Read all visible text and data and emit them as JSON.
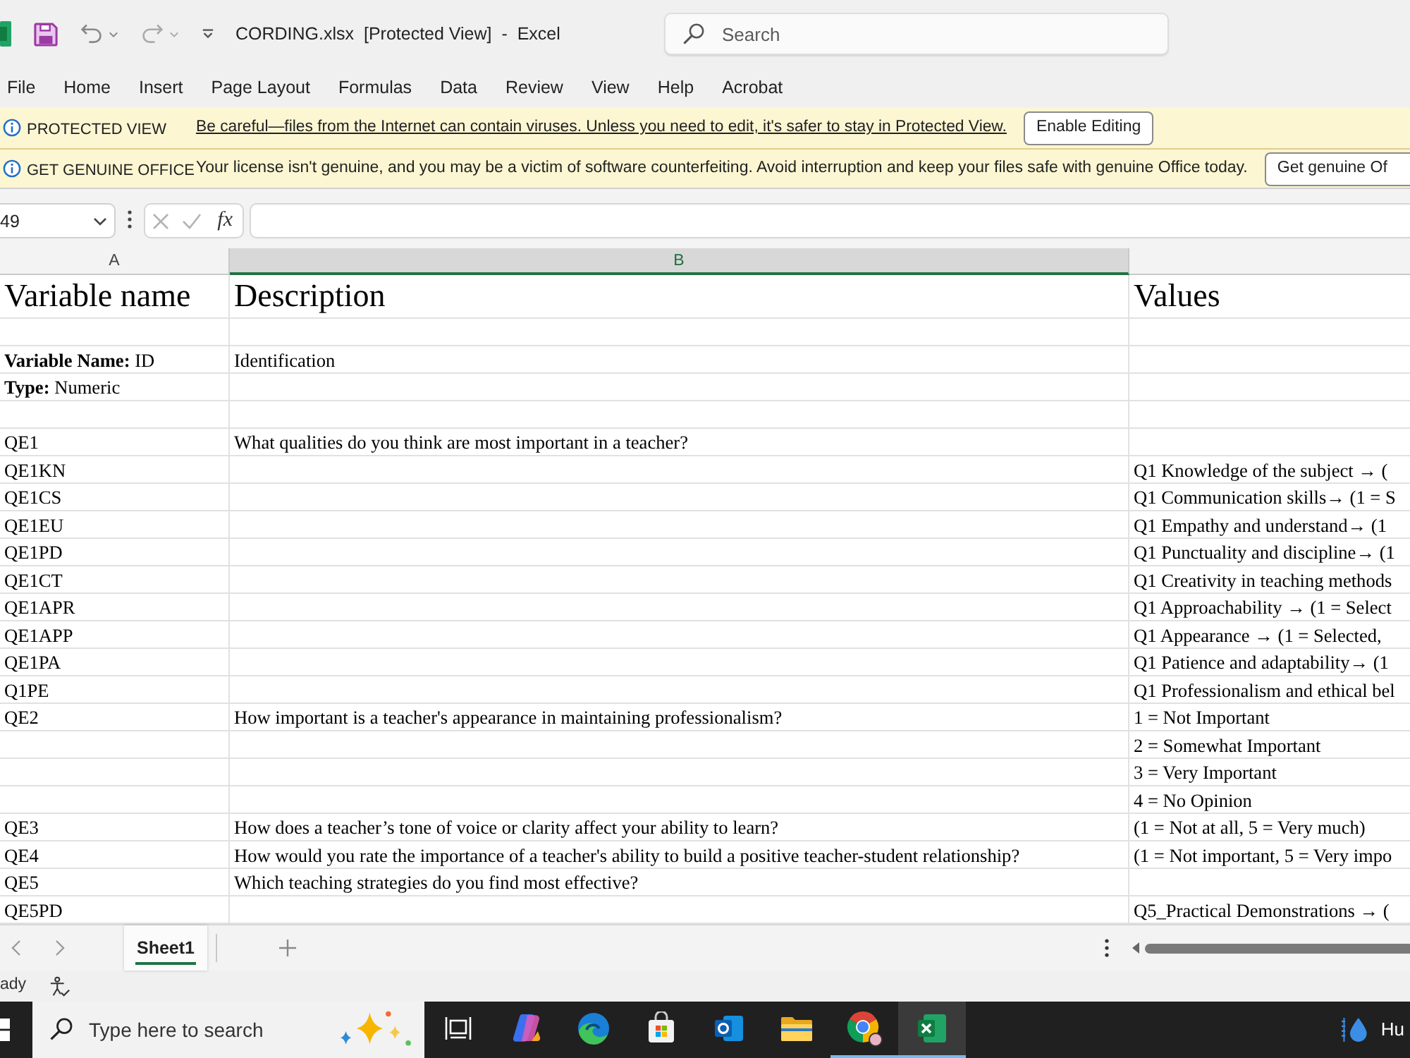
{
  "title_bar": {
    "title": "CORDING.xlsx  [Protected View]  -  Excel",
    "search": {
      "placeholder": "Search"
    }
  },
  "ribbon_tabs": [
    {
      "label": "File",
      "selected": false
    },
    {
      "label": "Home",
      "selected": false
    },
    {
      "label": "Insert",
      "selected": false
    },
    {
      "label": "Page Layout",
      "selected": false
    },
    {
      "label": "Formulas",
      "selected": false
    },
    {
      "label": "Data",
      "selected": false
    },
    {
      "label": "Review",
      "selected": false
    },
    {
      "label": "View",
      "selected": false
    },
    {
      "label": "Help",
      "selected": false
    },
    {
      "label": "Acrobat",
      "selected": false
    }
  ],
  "message_bars": [
    {
      "kind": "protected",
      "heading": "PROTECTED VIEW",
      "message": "Be careful—files from the Internet can contain viruses. Unless you need to edit, it's safer to stay in Protected View.",
      "button": "Enable Editing"
    },
    {
      "kind": "genuine",
      "heading": "GET GENUINE OFFICE",
      "message": "Your license isn't genuine, and you may be a victim of software counterfeiting. Avoid interruption and keep your files safe with genuine Office today.",
      "button": "Get genuine Of"
    }
  ],
  "formula_bar": {
    "name_box": "49",
    "function_label": "fx"
  },
  "columns": [
    {
      "label": "A",
      "selected": false
    },
    {
      "label": "B",
      "selected": true
    }
  ],
  "sheet": {
    "header": {
      "variable_name": "Variable name",
      "description": "Description",
      "values": "Values"
    },
    "rows": [
      {},
      {
        "variable_name": "**Variable Name:** ID",
        "description": "Identification"
      },
      {
        "variable_name": "**Type:** Numeric"
      },
      {},
      {
        "variable_name": "QE1",
        "description": "What qualities do you think are most important in a teacher?"
      },
      {
        "variable_name": "QE1KN",
        "values": "Q1 Knowledge of the subject → ("
      },
      {
        "variable_name": "QE1CS",
        "values": "Q1 Communication skills→ (1 = S"
      },
      {
        "variable_name": "QE1EU",
        "values": "Q1 Empathy and understand→ (1"
      },
      {
        "variable_name": "QE1PD",
        "values": "Q1 Punctuality and discipline→ (1"
      },
      {
        "variable_name": "QE1CT",
        "values": "Q1 Creativity in teaching methods"
      },
      {
        "variable_name": "QE1APR",
        "values": "Q1 Approachability → (1 = Select"
      },
      {
        "variable_name": "QE1APP",
        "values": "Q1 Appearance → (1 = Selected,"
      },
      {
        "variable_name": "QE1PA",
        "values": "Q1 Patience and adaptability→ (1"
      },
      {
        "variable_name": "Q1PE",
        "values": "Q1 Professionalism and ethical bel"
      },
      {
        "variable_name": "QE2",
        "description": "How important is a teacher's appearance in maintaining professionalism?",
        "values": "1 = Not Important"
      },
      {
        "values": "2 = Somewhat Important"
      },
      {
        "values": "3 = Very Important"
      },
      {
        "values": "4 = No Opinion"
      },
      {
        "variable_name": "QE3",
        "description": "How does a teacher’s tone of voice or clarity affect your ability to learn?",
        "values": "(1 = Not at all, 5 = Very much)"
      },
      {
        "variable_name": "QE4",
        "description": "How would you rate the importance of a teacher's ability to build a positive teacher-student relationship?",
        "values": "(1 = Not important, 5 = Very impo"
      },
      {
        "variable_name": "QE5",
        "description": "Which teaching strategies do you find most effective?"
      },
      {
        "variable_name": "QE5PD",
        "values": "Q5_Practical Demonstrations → ("
      }
    ]
  },
  "sheet_tabs": [
    {
      "label": "Sheet1",
      "selected": true
    }
  ],
  "status_bar": {
    "mode": "ady"
  },
  "taskbar": {
    "search": {
      "placeholder": "Type here to search"
    },
    "apps": [
      {
        "kind": "window-stack",
        "running": false,
        "selected": false
      },
      {
        "kind": "swirl",
        "running": false,
        "selected": false
      },
      {
        "kind": "wave-circle",
        "running": false,
        "selected": false
      },
      {
        "kind": "shopping-bag",
        "running": false,
        "selected": false
      },
      {
        "kind": "mail-tile",
        "running": false,
        "selected": false
      },
      {
        "kind": "folder",
        "running": false,
        "selected": false
      },
      {
        "kind": "ring-logo",
        "running": true,
        "selected": false
      },
      {
        "kind": "x-tile",
        "running": true,
        "selected": true
      }
    ],
    "weather": "Hu"
  }
}
